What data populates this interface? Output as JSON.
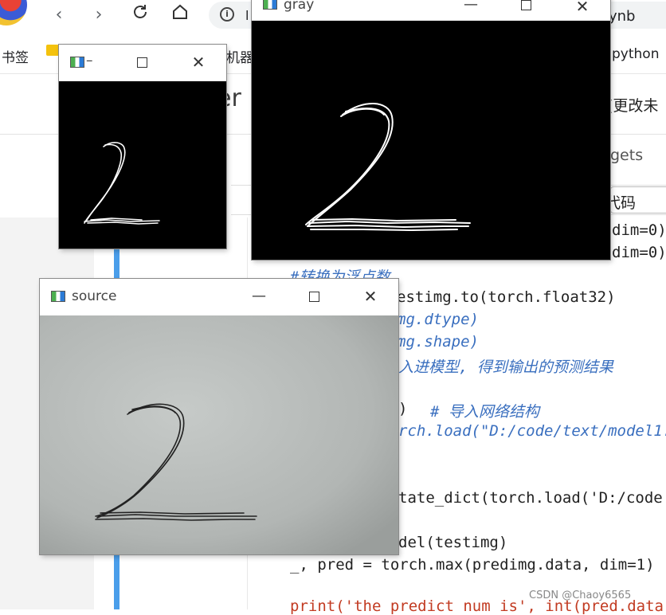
{
  "browser": {
    "address_partial": "l",
    "address_tail": "ynb",
    "bookmarks": [
      {
        "label": "书签"
      },
      {
        "label": "机器"
      },
      {
        "label": "python"
      }
    ]
  },
  "page": {
    "title_fragment": "er",
    "update_fragment": "(更改未",
    "tab_fragment": "gets",
    "code_button_fragment": "代码"
  },
  "code": {
    "dim0_a": "dim=0)",
    "dim0_b": "dim=0)",
    "comment_float": "#转换为浮点数",
    "to_float": "estimg.to(torch.float32)",
    "dtype_comment": "mg.dtype)",
    "shape_comment": "mg.shape)",
    "predict_comment": "入进模型, 得到输出的预测结果",
    "net_comment_prefix": ")",
    "net_comment": "# 导入网络结构",
    "load_model": "rch.load(\"D:/code/text/model1.",
    "load_state": "tate_dict(torch.load('D:/code",
    "model_call": "del(testimg)",
    "pred_line": "_, pred = torch.max(predimg.data, dim=1)",
    "print_line": "print('the predict num is', int(pred.data"
  },
  "windows": {
    "small": {
      "title": "",
      "min_glyph": "–"
    },
    "gray": {
      "title": "gray"
    },
    "source": {
      "title": "source"
    }
  },
  "watermark": "CSDN @Chaoy6565",
  "colors": {
    "blue_gutter": "#4a9eea",
    "comment": "#3a6fbf",
    "string": "#c23b22"
  }
}
